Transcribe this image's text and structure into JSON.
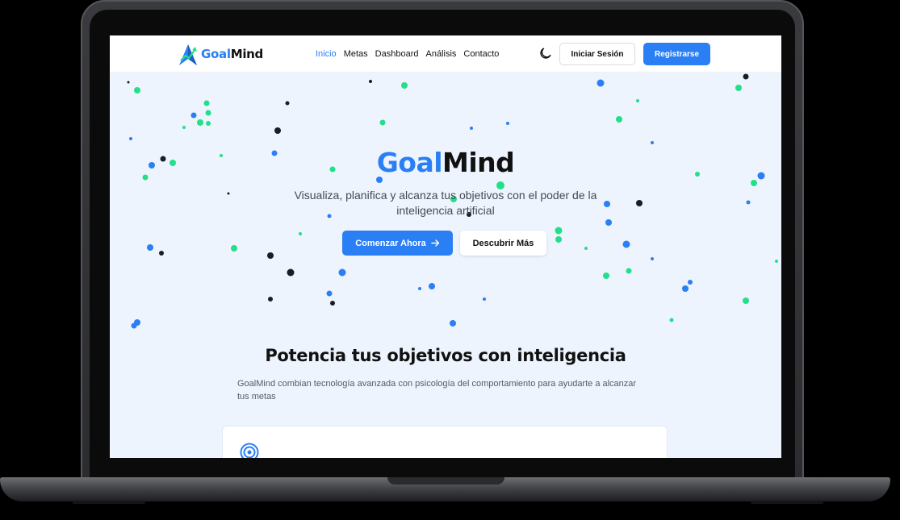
{
  "brand": {
    "part1": "Goal",
    "part2": "Mind"
  },
  "nav": {
    "links": [
      "Inicio",
      "Metas",
      "Dashboard",
      "Análisis",
      "Contacto"
    ],
    "active_index": 0,
    "login_label": "Iniciar Sesión",
    "register_label": "Registrarse"
  },
  "hero": {
    "title_part1": "Goal",
    "title_part2": "Mind",
    "subtitle": "Visualiza, planifica y alcanza tus objetivos con el poder de la inteligencia artificial",
    "cta_primary": "Comenzar Ahora",
    "cta_primary_icon": "arrow-right-icon",
    "cta_secondary": "Descubrir Más"
  },
  "features": {
    "title": "Potencia tus objetivos con inteligencia",
    "subtitle": "GoalMind combian tecnología avanzada con psicología del comportamiento para ayudarte a alcanzar tus metas",
    "first_card_icon": "target-icon"
  },
  "icons": {
    "theme_toggle": "moon-icon",
    "logo": "goalmind-logo"
  },
  "colors": {
    "primary": "#2b7ff5",
    "accent_green": "#22e08a",
    "dark": "#1a1d24",
    "hero_bg": "#eef4fd"
  }
}
